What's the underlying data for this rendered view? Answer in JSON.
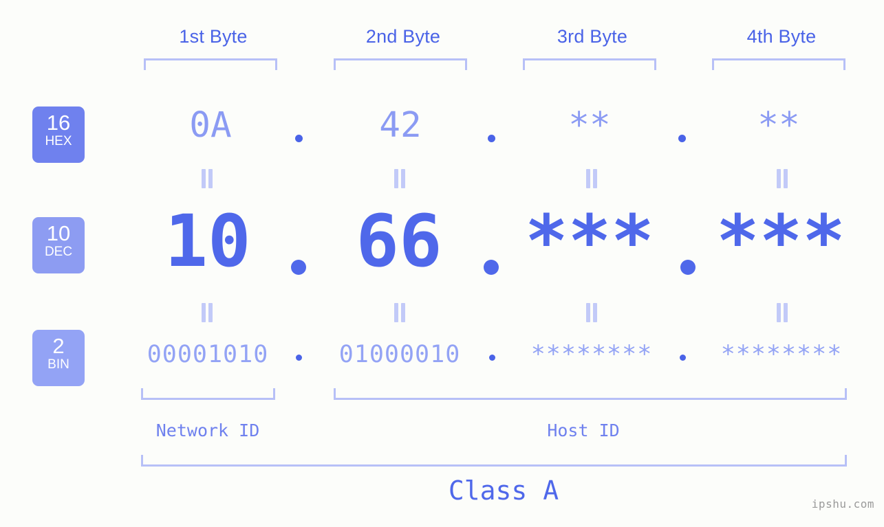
{
  "background_color": "#fcfdfa",
  "accent_color": "#4f68ea",
  "bracket_color": "#b7c0f7",
  "header": {
    "bytes": [
      {
        "label": "1st Byte"
      },
      {
        "label": "2nd Byte"
      },
      {
        "label": "3rd Byte"
      },
      {
        "label": "4th Byte"
      }
    ]
  },
  "bases": [
    {
      "id": "hex",
      "number": "16",
      "name": "HEX",
      "color": "#6f81ee"
    },
    {
      "id": "dec",
      "number": "10",
      "name": "DEC",
      "color": "#8d9cf2"
    },
    {
      "id": "bin",
      "number": "2",
      "name": "BIN",
      "color": "#93a3f5"
    }
  ],
  "rows": {
    "hex": {
      "values": [
        "0A",
        "42",
        "**",
        "**"
      ],
      "separator": "."
    },
    "dec": {
      "values": [
        "10",
        "66",
        "***",
        "***"
      ],
      "separator": "."
    },
    "bin": {
      "values": [
        "00001010",
        "01000010",
        "********",
        "********"
      ],
      "separator": "."
    }
  },
  "equals_symbol": "=",
  "footer": {
    "network_id_label": "Network ID",
    "host_id_label": "Host ID",
    "class_label": "Class A"
  },
  "watermark": "ipshu.com"
}
